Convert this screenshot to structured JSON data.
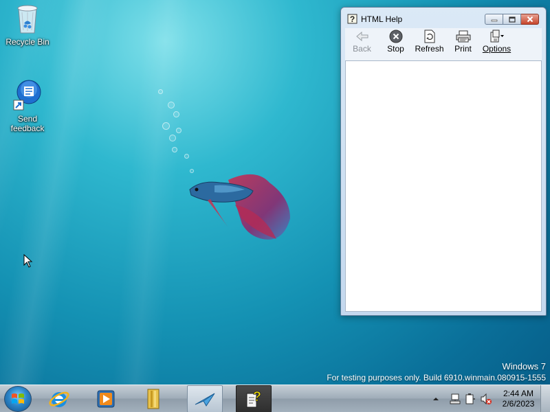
{
  "desktop": {
    "icons": [
      {
        "label": "Recycle Bin",
        "icon": "recycle-bin-icon"
      },
      {
        "label": "Send\nfeedback",
        "icon": "send-feedback-icon"
      }
    ],
    "watermark": {
      "title": "Windows  7",
      "build": "For testing purposes only. Build 6910.winmain.080915-1555"
    }
  },
  "window": {
    "title": "HTML Help",
    "title_icon": "help-icon",
    "caption_buttons": [
      "minimize-icon",
      "maximize-icon",
      "close-icon"
    ],
    "toolbar": [
      {
        "label": "Back",
        "icon": "back-arrow-icon",
        "enabled": false
      },
      {
        "label": "Stop",
        "icon": "stop-icon",
        "enabled": true
      },
      {
        "label": "Refresh",
        "icon": "refresh-icon",
        "enabled": true
      },
      {
        "label": "Print",
        "icon": "printer-icon",
        "enabled": true
      },
      {
        "label": "Options",
        "icon": "options-icon",
        "enabled": true
      }
    ]
  },
  "taskbar": {
    "start_icon": "windows-logo-icon",
    "pinned": [
      "internet-explorer-icon",
      "media-player-icon",
      "library-folder-icon",
      "messenger-icon",
      "html-help-icon"
    ],
    "tray_icons": [
      "show-hidden-icons-chevron",
      "network-icon",
      "power-icon",
      "volume-muted-icon"
    ],
    "clock": {
      "time": "2:44 AM",
      "date": "2/6/2023"
    }
  },
  "colors": {
    "desktop_top": "#7fe0ea",
    "desktop_bottom": "#065b86",
    "window_frame": "#c4d8ee",
    "close_button": "#c6452c"
  }
}
